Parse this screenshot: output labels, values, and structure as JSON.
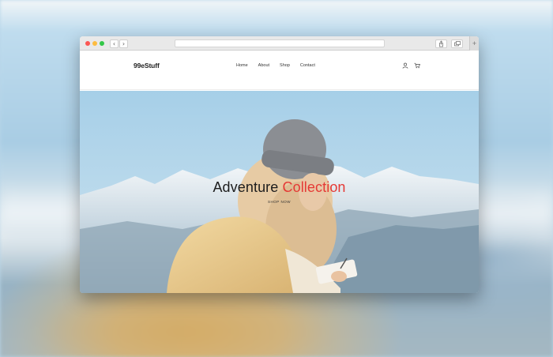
{
  "browser": {
    "back_icon": "‹",
    "forward_icon": "›",
    "share_icon": "share-icon",
    "tabs_icon": "tabs-icon",
    "newtab_icon": "+"
  },
  "site": {
    "logo": "99eStuff",
    "nav": [
      "Home",
      "About",
      "Shop",
      "Contact"
    ],
    "icons": [
      "user-icon",
      "cart-icon"
    ]
  },
  "hero": {
    "title_main": "Adventure ",
    "title_accent": "Collection",
    "subtitle": "SHOP NOW",
    "accent_color": "#e53935"
  }
}
